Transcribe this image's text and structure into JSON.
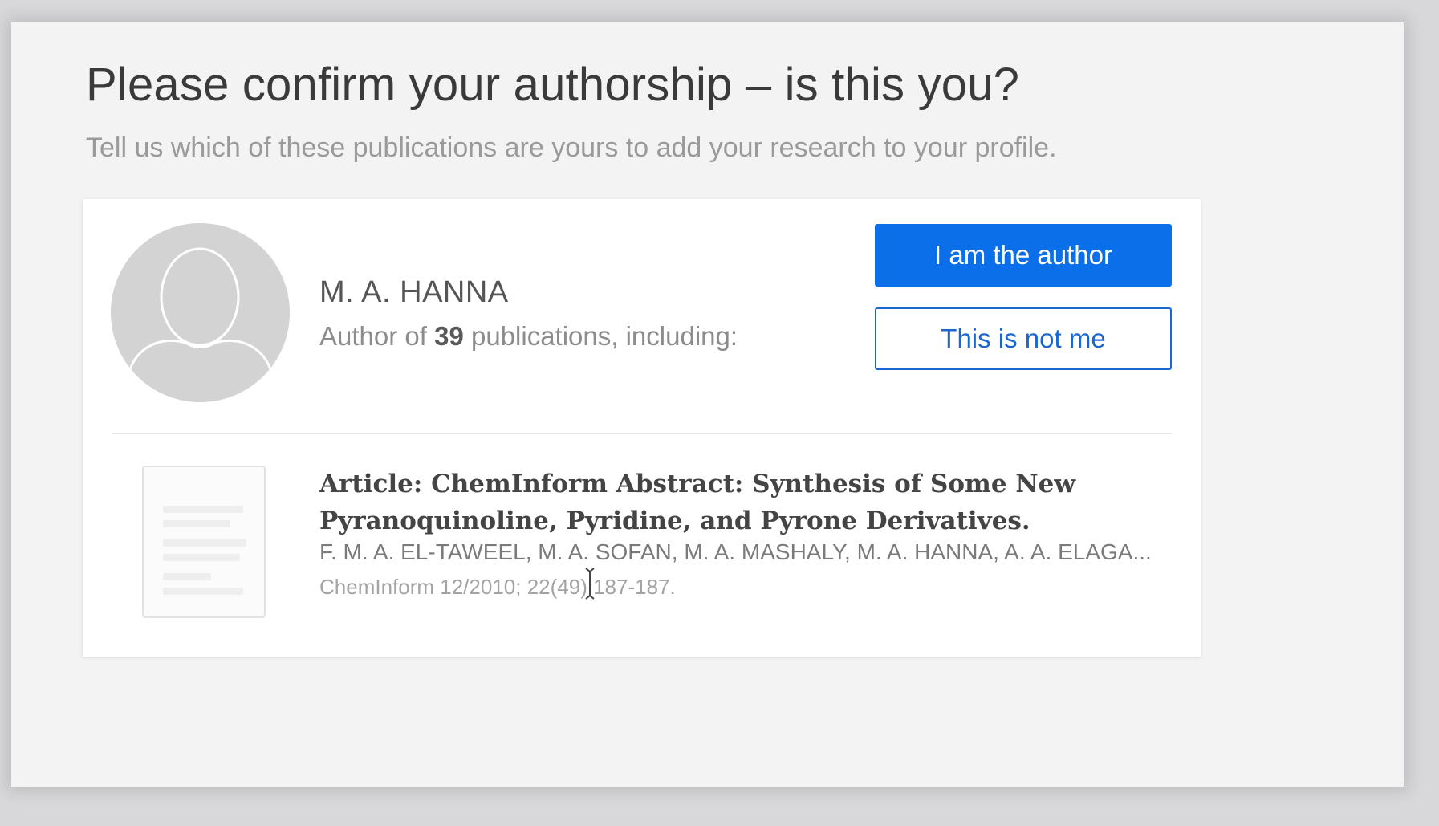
{
  "header": {
    "title": "Please confirm your authorship – is this you?",
    "subtitle": "Tell us which of these publications are yours to add your research to your profile."
  },
  "author": {
    "name": "M. A. HANNA",
    "meta_prefix": "Author of ",
    "publication_count": "39",
    "meta_suffix": " publications, including:",
    "avatar_icon": "person-silhouette-icon"
  },
  "actions": {
    "confirm_label": "I am the author",
    "reject_label": "This is not me",
    "accent_color": "#0a6fe8"
  },
  "publication": {
    "title": "Article: ChemInform Abstract: Synthesis of Some New Pyranoquinoline, Pyridine, and Pyrone Derivatives.",
    "authors": "F. M. A. EL-TAWEEL, M. A. SOFAN, M. A. MASHALY, M. A. HANNA, A. A. ELAGA...",
    "source": "ChemInform 12/2010; 22(49):187-187.",
    "thumbnail_icon": "document-thumbnail-icon"
  }
}
